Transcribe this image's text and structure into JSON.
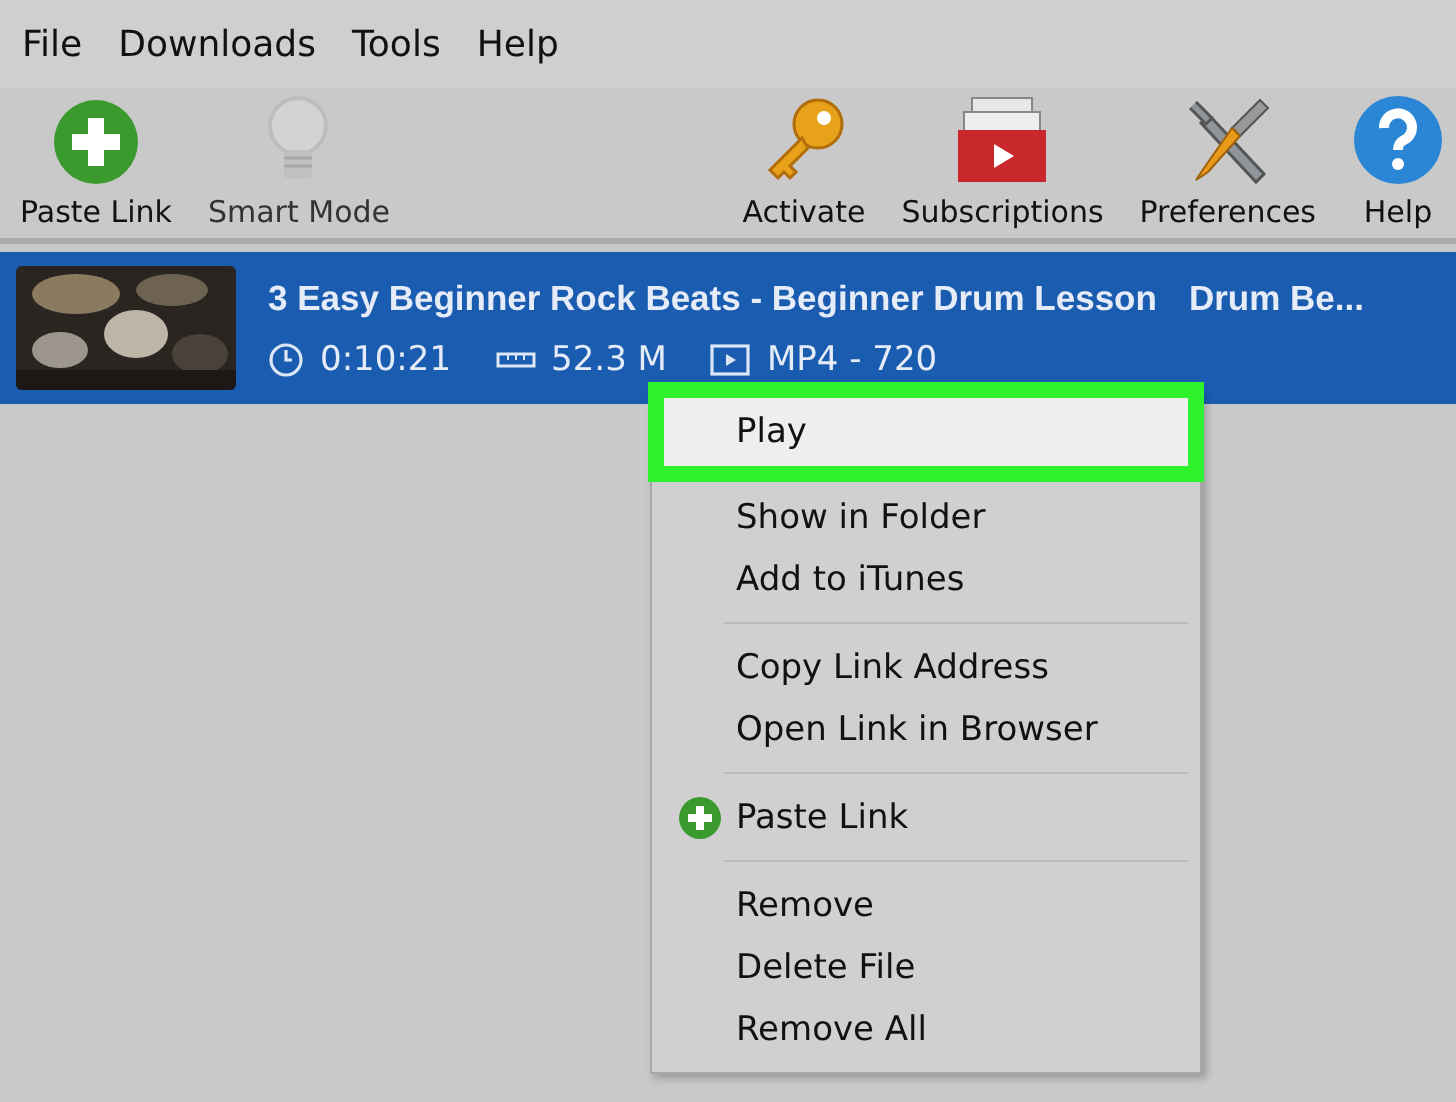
{
  "menu_bar": [
    "File",
    "Downloads",
    "Tools",
    "Help"
  ],
  "toolbar": {
    "left": [
      {
        "label": "Paste Link",
        "kind": "paste",
        "disabled": false
      },
      {
        "label": "Smart Mode",
        "kind": "bulb",
        "disabled": true
      }
    ],
    "right": [
      {
        "label": "Activate",
        "kind": "key",
        "disabled": false
      },
      {
        "label": "Subscriptions",
        "kind": "subscriptions",
        "disabled": false
      },
      {
        "label": "Preferences",
        "kind": "tools",
        "disabled": false
      },
      {
        "label": "Help",
        "kind": "help",
        "disabled": false
      }
    ]
  },
  "downloads": [
    {
      "title": "3 Easy Beginner Rock Beats - Beginner Drum Lesson",
      "channel": "Drum Be...",
      "duration": "0:10:21",
      "size": "52.3 M",
      "format": "MP4 - 720",
      "selected": true
    }
  ],
  "context_menu": {
    "groups": [
      [
        {
          "label": "Play",
          "highlighted": true,
          "kind": "plain"
        },
        {
          "label": "Show in Folder",
          "highlighted": false,
          "kind": "plain"
        },
        {
          "label": "Add to iTunes",
          "highlighted": false,
          "kind": "plain"
        }
      ],
      [
        {
          "label": "Copy Link Address",
          "highlighted": false,
          "kind": "plain"
        },
        {
          "label": "Open Link in Browser",
          "highlighted": false,
          "kind": "plain"
        }
      ],
      [
        {
          "label": "Paste Link",
          "highlighted": false,
          "kind": "paste"
        }
      ],
      [
        {
          "label": "Remove",
          "highlighted": false,
          "kind": "plain"
        },
        {
          "label": "Delete File",
          "highlighted": false,
          "kind": "plain"
        },
        {
          "label": "Remove All",
          "highlighted": false,
          "kind": "plain"
        }
      ]
    ]
  }
}
